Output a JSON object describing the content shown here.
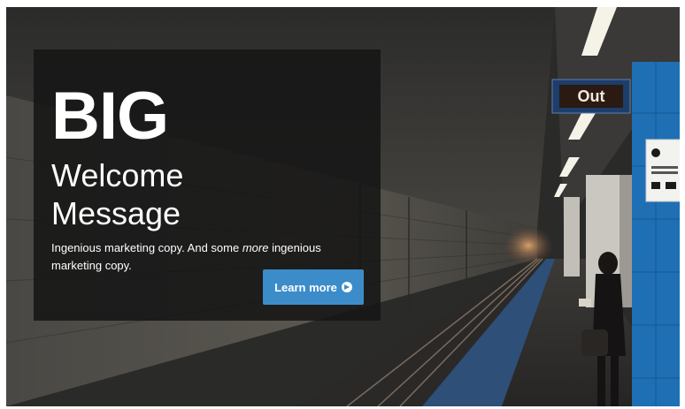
{
  "hero": {
    "headline_big": "BIG",
    "headline_line1": "Welcome",
    "headline_line2": "Message",
    "body_part1": "Ingenious marketing copy. And some ",
    "body_emphasis": "more",
    "body_part2": " ingenious marketing copy.",
    "cta_label": "Learn more",
    "cta_icon": "arrow-circle-right-icon"
  },
  "scene": {
    "exit_sign_text": "Out"
  },
  "colors": {
    "cta_background": "#3c8cc9",
    "overlay_background": "#161616",
    "pillar_blue": "#1f6fb5"
  }
}
